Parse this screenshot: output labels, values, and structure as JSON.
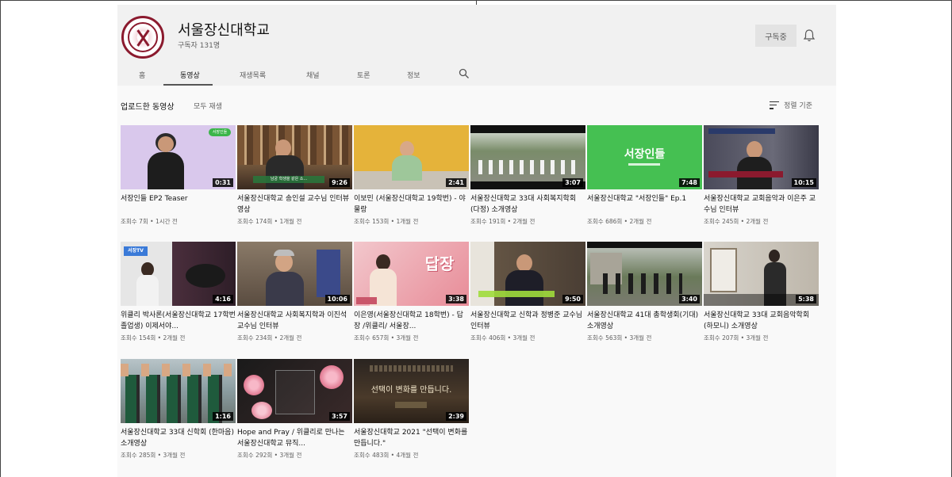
{
  "channel": {
    "name": "서울장신대학교",
    "subscribers": "구독자 131명",
    "subscribe_label": "구독중"
  },
  "tabs": [
    {
      "label": "홈"
    },
    {
      "label": "동영상"
    },
    {
      "label": "재생목록"
    },
    {
      "label": "채널"
    },
    {
      "label": "토론"
    },
    {
      "label": "정보"
    }
  ],
  "section": {
    "title": "업로드한 동영상",
    "play_all": "모두 재생",
    "sort_label": "정렬 기준"
  },
  "videos": [
    {
      "title": "서장인들 EP2 Teaser",
      "meta": "조회수 7회 • 1시간 전",
      "duration": "0:31",
      "badge": "서장인들"
    },
    {
      "title": "서울장신대학교 송인설 교수님 인터뷰 영상",
      "meta": "조회수 174회 • 1개월 전",
      "duration": "9:26",
      "caption": "남궁 학생을 같은 소..."
    },
    {
      "title": "이보민 (서울장신대학교 19학번) - 야 물랑",
      "meta": "조회수 153회 • 1개월 전",
      "duration": "2:41"
    },
    {
      "title": "서울장신대학교 33대 사회복지학회 (다정) 소개영상",
      "meta": "조회수 191회 • 2개월 전",
      "duration": "3:07"
    },
    {
      "title": "서울장신대학교 \"서장인들\" Ep.1",
      "meta": "조회수 686회 • 2개월 전",
      "duration": "7:48",
      "badge": "서장인들"
    },
    {
      "title": "서울장신대학교 교회음악과 이은주 교수님 인터뷰",
      "meta": "조회수 245회 • 2개월 전",
      "duration": "10:15"
    },
    {
      "title": "위클리 박사론(서울장신대학교 17학번 졸업생) 이제서야...",
      "meta": "조회수 154회 • 2개월 전",
      "duration": "4:16",
      "badge": "서장TV"
    },
    {
      "title": "서울장신대학교 사회복지학과 이진석교수님 인터뷰",
      "meta": "조회수 234회 • 2개월 전",
      "duration": "10:06"
    },
    {
      "title": "이은영(서울장신대학교 18학번) - 답장 /위클리/ 서울장...",
      "meta": "조회수 657회 • 3개월 전",
      "duration": "3:38",
      "badge": "답장"
    },
    {
      "title": "서울장신대학교 신학과 정병준 교수님 인터뷰",
      "meta": "조회수 406회 • 3개월 전",
      "duration": "9:50"
    },
    {
      "title": "서울장신대학교 41대 총학생회(기대) 소개영상",
      "meta": "조회수 563회 • 3개월 전",
      "duration": "3:40"
    },
    {
      "title": "서울장신대학교 33대 교회음악학회 (하모니) 소개영상",
      "meta": "조회수 207회 • 3개월 전",
      "duration": "5:38"
    },
    {
      "title": "서울장신대학교 33대 신학회 (한마음) 소개영상",
      "meta": "조회수 285회 • 3개월 전",
      "duration": "1:16"
    },
    {
      "title": "Hope and Pray / 위클리로 만나는 서울장신대학교 뮤직...",
      "meta": "조회수 292회 • 3개월 전",
      "duration": "3:57"
    },
    {
      "title": "서울장신대학교 2021 \"선택이 변화를 만듭니다.\"",
      "meta": "조회수 483회 • 4개월 전",
      "duration": "2:39",
      "badge": "선택이 변화를 만듭니다."
    }
  ],
  "colors": {
    "brand": "#8b1a2e",
    "page_bg": "#f9f9f9",
    "header_bg": "#f1f1f1"
  },
  "icons": [
    "bell-icon",
    "search-icon",
    "sort-icon"
  ]
}
